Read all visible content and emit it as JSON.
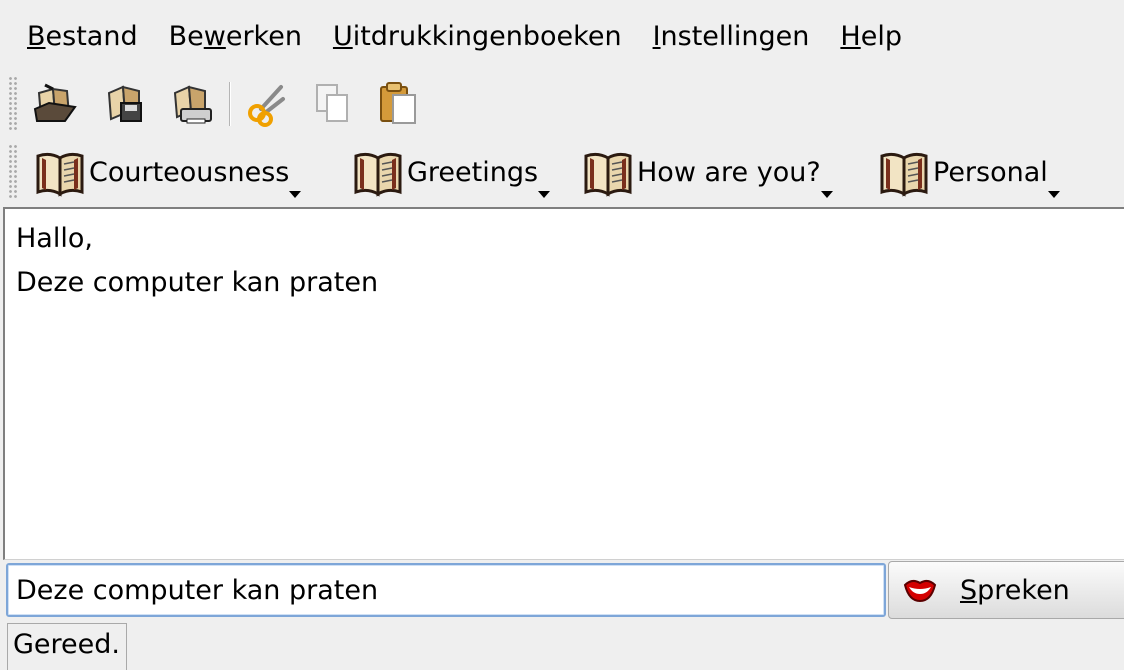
{
  "menubar": {
    "items": [
      {
        "accel": "B",
        "rest": "estand",
        "pre": ""
      },
      {
        "pre": "Be",
        "accel": "w",
        "rest": "erken"
      },
      {
        "pre": "",
        "accel": "U",
        "rest": "itdrukkingenboeken"
      },
      {
        "pre": "",
        "accel": "I",
        "rest": "nstellingen"
      },
      {
        "pre": "",
        "accel": "H",
        "rest": "elp"
      }
    ]
  },
  "toolbar": {
    "icons": [
      "open-book-icon",
      "save-book-icon",
      "print-book-icon",
      "cut-icon",
      "copy-icon",
      "paste-icon"
    ]
  },
  "phrasebooks": {
    "items": [
      {
        "label": "Courteousness",
        "icon": "phrasebook-icon"
      },
      {
        "label": "Greetings",
        "icon": "phrasebook-icon"
      },
      {
        "label": "How are you?",
        "icon": "phrasebook-icon"
      },
      {
        "label": "Personal",
        "icon": "phrasebook-icon"
      }
    ]
  },
  "history": {
    "lines": [
      "Hallo,",
      "Deze computer kan praten"
    ]
  },
  "input": {
    "value": "Deze computer kan praten"
  },
  "speak": {
    "accel": "S",
    "rest": "preken",
    "icon": "lips-icon"
  },
  "status": {
    "text": "Gereed."
  },
  "colors": {
    "window_bg": "#efefef",
    "input_border": "#7ea6d8",
    "lips_red": "#d40000"
  }
}
